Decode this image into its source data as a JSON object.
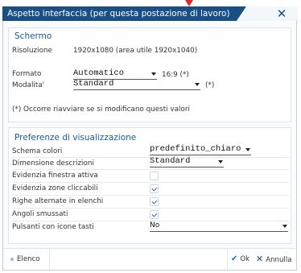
{
  "window": {
    "title": "Aspetto interfaccia (per questa postazione di lavoro)",
    "close_label": "✕"
  },
  "screen": {
    "section_title": "Schermo",
    "resolution_label": "Risoluzione",
    "resolution_value": "1920x1080  (area utile 1920x1040)",
    "format_label": "Formato",
    "format_value": "Automatico",
    "format_ratio": "16:9 (*)",
    "mode_label": "Modalita'",
    "mode_value": "Standard",
    "mode_note": "(*)",
    "restart_note": "(*) Occorre riavviare se si modificano questi valori"
  },
  "prefs": {
    "section_title": "Preferenze di visualizzazione",
    "color_scheme_label": "Schema colori",
    "color_scheme_value": "predefinito_chiaro",
    "desc_size_label": "Dimensione descrizioni",
    "desc_size_value": "Standard",
    "active_window_label": "Evidenzia finestra attiva",
    "clickable_zones_label": "Evidenzia zone cliccabili",
    "alternate_rows_label": "Righe alternate in elenchi",
    "rounded_corners_label": "Angoli smussati",
    "key_icons_label": "Pulsanti con icone tasti",
    "key_icons_value": "No",
    "checks": {
      "active_window": false,
      "clickable_zones": true,
      "alternate_rows": true,
      "rounded_corners": true
    }
  },
  "footer": {
    "list_label": "Elenco",
    "ok_label": "Ok",
    "cancel_label": "Annulla"
  },
  "colors": {
    "title_bg": "#1a4f86",
    "accent": "#1a5aa0",
    "check": "#1e66b8"
  }
}
